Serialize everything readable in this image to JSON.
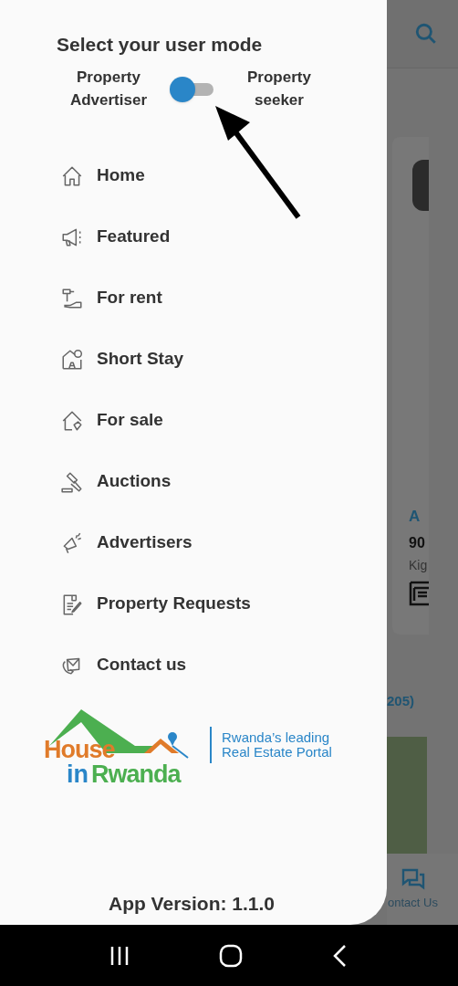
{
  "drawer": {
    "mode_title": "Select your user mode",
    "mode_switch": {
      "left_label": "Property Advertiser",
      "right_label": "Property seeker",
      "on": false
    },
    "menu": [
      {
        "label": "Home"
      },
      {
        "label": "Featured"
      },
      {
        "label": "For rent"
      },
      {
        "label": "Short Stay"
      },
      {
        "label": "For sale"
      },
      {
        "label": "Auctions"
      },
      {
        "label": "Advertisers"
      },
      {
        "label": "Property Requests"
      },
      {
        "label": "Contact us"
      }
    ],
    "logo": {
      "word_1": "House",
      "word_2": "in",
      "word_3": "Rwanda",
      "tagline_1": "Rwanda’s leading",
      "tagline_2": "Real Estate Portal"
    },
    "app_version": "App Version: 1.1.0"
  },
  "background": {
    "card_title": "A",
    "card_price": "90",
    "card_location": "Kig",
    "section_count": "205)",
    "bottom_nav_label": "ontact Us"
  }
}
